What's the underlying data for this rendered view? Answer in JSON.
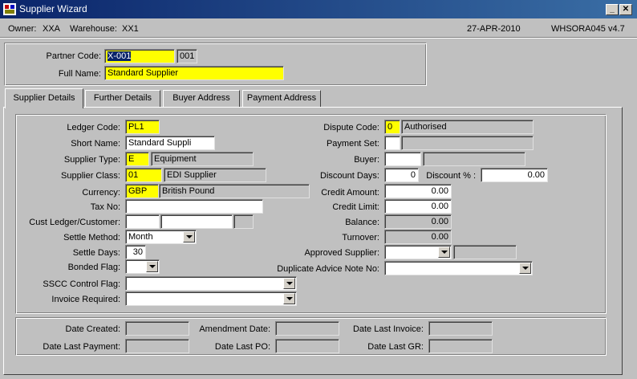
{
  "window": {
    "title": "Supplier Wizard",
    "minimize": "_",
    "close": "✕"
  },
  "info": {
    "owner_label": "Owner:",
    "owner": "XXA",
    "warehouse_label": "Warehouse:",
    "warehouse": "XX1",
    "date": "27-APR-2010",
    "screen_id": "WHSORA045",
    "version": "v4.7"
  },
  "header": {
    "partner_code_label": "Partner Code:",
    "partner_code": "X-001",
    "partner_code_suffix": "001",
    "full_name_label": "Full Name:",
    "full_name": "Standard Supplier"
  },
  "tabs": [
    {
      "label": "Supplier Details",
      "active": true
    },
    {
      "label": "Further Details",
      "active": false
    },
    {
      "label": "Buyer Address",
      "active": false
    },
    {
      "label": "Payment Address",
      "active": false
    }
  ],
  "left": {
    "ledger_code_label": "Ledger Code:",
    "ledger_code": "PL1",
    "short_name_label": "Short Name:",
    "short_name": "Standard Suppli",
    "supplier_type_label": "Supplier Type:",
    "supplier_type": "E",
    "supplier_type_desc": "Equipment",
    "supplier_class_label": "Supplier Class:",
    "supplier_class": "01",
    "supplier_class_desc": "EDI Supplier",
    "currency_label": "Currency:",
    "currency": "GBP",
    "currency_desc": "British Pound",
    "tax_no_label": "Tax No:",
    "tax_no": "",
    "cust_ledger_label": "Cust Ledger/Customer:",
    "settle_method_label": "Settle Method:",
    "settle_method": "Month",
    "settle_days_label": "Settle Days:",
    "settle_days": "30",
    "bonded_flag_label": "Bonded Flag:",
    "bonded_flag": "",
    "sscc_label": "SSCC Control Flag:",
    "sscc": "",
    "invoice_required_label": "Invoice Required:",
    "invoice_required": ""
  },
  "right": {
    "dispute_code_label": "Dispute Code:",
    "dispute_code": "0",
    "dispute_code_desc": "Authorised",
    "payment_set_label": "Payment Set:",
    "buyer_label": "Buyer:",
    "discount_days_label": "Discount Days:",
    "discount_days": "0",
    "discount_pct_label": "Discount % :",
    "discount_pct": "0.00",
    "credit_amount_label": "Credit Amount:",
    "credit_amount": "0.00",
    "credit_limit_label": "Credit Limit:",
    "credit_limit": "0.00",
    "balance_label": "Balance:",
    "balance": "0.00",
    "turnover_label": "Turnover:",
    "turnover": "0.00",
    "approved_supplier_label": "Approved Supplier:",
    "duplicate_advice_label": "Duplicate Advice Note No:"
  },
  "footer": {
    "date_created_label": "Date Created:",
    "amendment_date_label": "Amendment Date:",
    "date_last_invoice_label": "Date Last Invoice:",
    "date_last_payment_label": "Date Last Payment:",
    "date_last_po_label": "Date Last PO:",
    "date_last_gr_label": "Date Last GR:"
  }
}
